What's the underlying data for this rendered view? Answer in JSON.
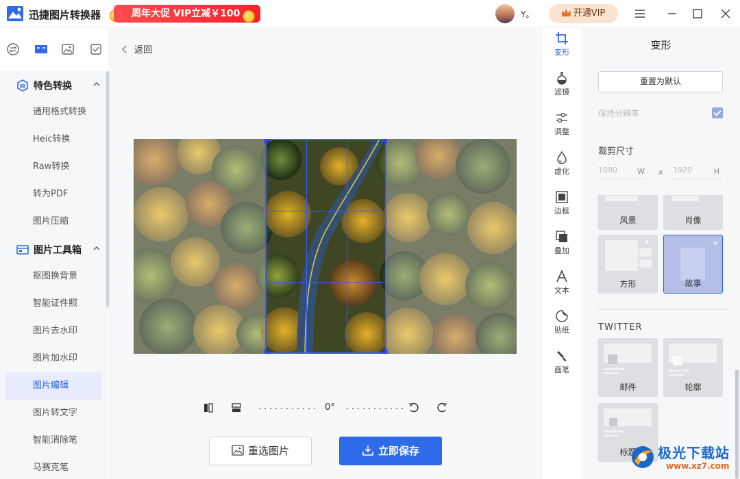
{
  "app": {
    "title": "迅捷图片转换器",
    "promo": "周年大促 VIP立减￥100",
    "username": "Y。",
    "vip_button": "开通VIP",
    "accent_color": "#2f6be8"
  },
  "sidebar": {
    "tabs": [
      "convert-icon",
      "toolbox-icon",
      "image-icon",
      "check-icon"
    ],
    "groups": [
      {
        "label": "特色转换",
        "items": [
          "通用格式转换",
          "Heic转换",
          "Raw转换",
          "转为PDF",
          "图片压缩"
        ]
      },
      {
        "label": "图片工具箱",
        "items": [
          "抠图换背景",
          "智能证件照",
          "图片去水印",
          "图片加水印",
          "图片编辑",
          "图片转文字",
          "智能消除笔",
          "马赛克笔"
        ]
      }
    ],
    "active_item": "图片编辑"
  },
  "main": {
    "back_label": "返回",
    "rotation": "0°",
    "reselect_label": "重选图片",
    "save_label": "立即保存"
  },
  "toolstrip": {
    "tools": [
      {
        "label": "变形",
        "icon": "crop-icon",
        "active": true
      },
      {
        "label": "滤镜",
        "icon": "flask-icon",
        "active": false
      },
      {
        "label": "调整",
        "icon": "sliders-icon",
        "active": false
      },
      {
        "label": "虚化",
        "icon": "drop-icon",
        "active": false
      },
      {
        "label": "边框",
        "icon": "frame-icon",
        "active": false
      },
      {
        "label": "叠加",
        "icon": "layers-icon",
        "active": false
      },
      {
        "label": "文本",
        "icon": "text-icon",
        "active": false
      },
      {
        "label": "贴纸",
        "icon": "sticker-icon",
        "active": false
      },
      {
        "label": "画笔",
        "icon": "brush-icon",
        "active": false
      }
    ]
  },
  "panel": {
    "title": "变形",
    "reset_label": "重置为默认",
    "keep_resolution_label": "保持分辨率",
    "keep_resolution_checked": true,
    "crop_size_label": "裁剪尺寸",
    "width_placeholder": "1080",
    "width_unit": "W",
    "height_placeholder": "1920",
    "height_unit": "H",
    "separator": "x",
    "presets": [
      {
        "label": "风景",
        "selected": false
      },
      {
        "label": "肖像",
        "selected": false
      },
      {
        "label": "方形",
        "selected": false
      },
      {
        "label": "故事",
        "selected": true
      }
    ],
    "twitter_title": "TWITTER",
    "twitter_presets": [
      {
        "label": "邮件"
      },
      {
        "label": "轮廓"
      },
      {
        "label": "标题"
      }
    ]
  },
  "watermark": {
    "text": "极光下载站",
    "url": "www.xz7.com"
  }
}
